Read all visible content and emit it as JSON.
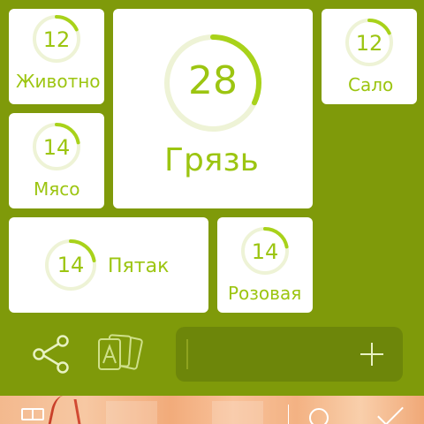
{
  "colors": {
    "background": "#7f9a0a",
    "tile": "#ffffff",
    "accent": "#9cc511",
    "ring_track": "#eef3d6",
    "ring_progress": "#a8d21a",
    "input_bg": "#6d860a"
  },
  "tiles": [
    {
      "id": "zhivotnoe",
      "number": "12",
      "label": "Животно",
      "progress": 0.18
    },
    {
      "id": "gryaz",
      "number": "28",
      "label": "Грязь",
      "progress": 0.32
    },
    {
      "id": "salo",
      "number": "12",
      "label": "Сало",
      "progress": 0.18
    },
    {
      "id": "myaso",
      "number": "14",
      "label": "Мясо",
      "progress": 0.22
    },
    {
      "id": "pyatak",
      "number": "14",
      "label": "Пятак",
      "progress": 0.22
    },
    {
      "id": "rozovaya",
      "number": "14",
      "label": "Розовая",
      "progress": 0.22
    }
  ],
  "toolbar": {
    "share_icon": "share-icon",
    "cards_icon": "cards-a-icon",
    "input_value": "",
    "add_icon": "plus-icon"
  },
  "system_bar": {
    "icons": [
      "grid-icon",
      "search-icon",
      "chevron-icon"
    ]
  }
}
